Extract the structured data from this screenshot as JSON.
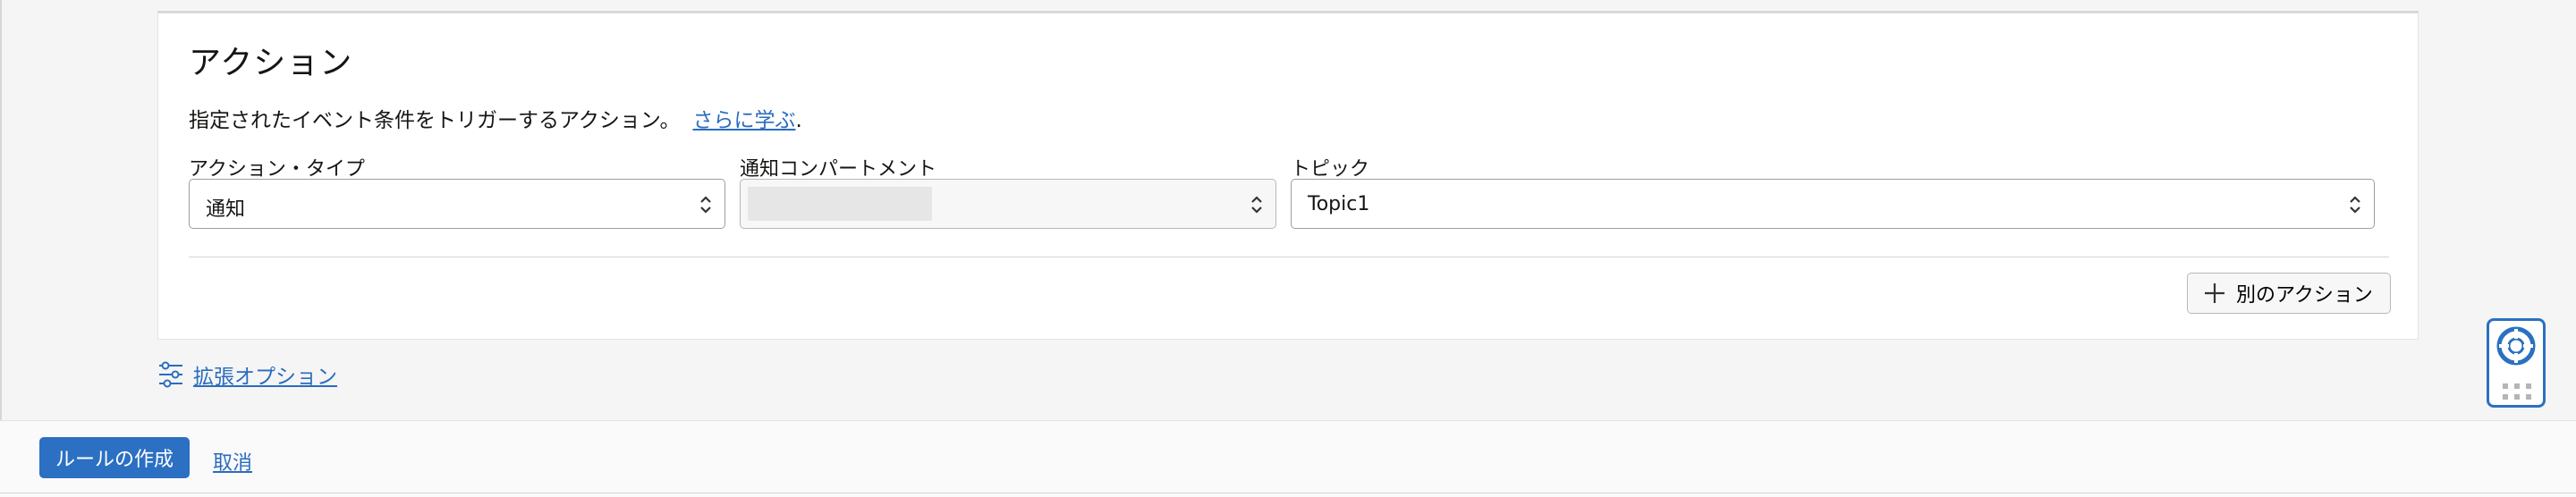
{
  "actions_section": {
    "title": "アクション",
    "description": "指定されたイベント条件をトリガーするアクション。",
    "learn_more": "さらに学ぶ",
    "learn_more_suffix": ".",
    "fields": {
      "action_type": {
        "label": "アクション・タイプ",
        "value": "通知"
      },
      "compartment": {
        "label": "通知コンパートメント",
        "value": ""
      },
      "topic": {
        "label": "トピック",
        "value": "Topic1"
      }
    },
    "add_action_label": "別のアクション"
  },
  "advanced_options_label": "拡張オプション",
  "footer": {
    "create_rule_label": "ルールの作成",
    "cancel_label": "取消"
  },
  "colors": {
    "accent": "#2b70c2",
    "link": "#2a6cbf"
  },
  "icons": {
    "select_chevron": "chevron-up-down-icon",
    "add": "plus-icon",
    "advanced": "sliders-icon",
    "help": "lifebuoy-icon",
    "drag": "drag-grip-icon"
  }
}
